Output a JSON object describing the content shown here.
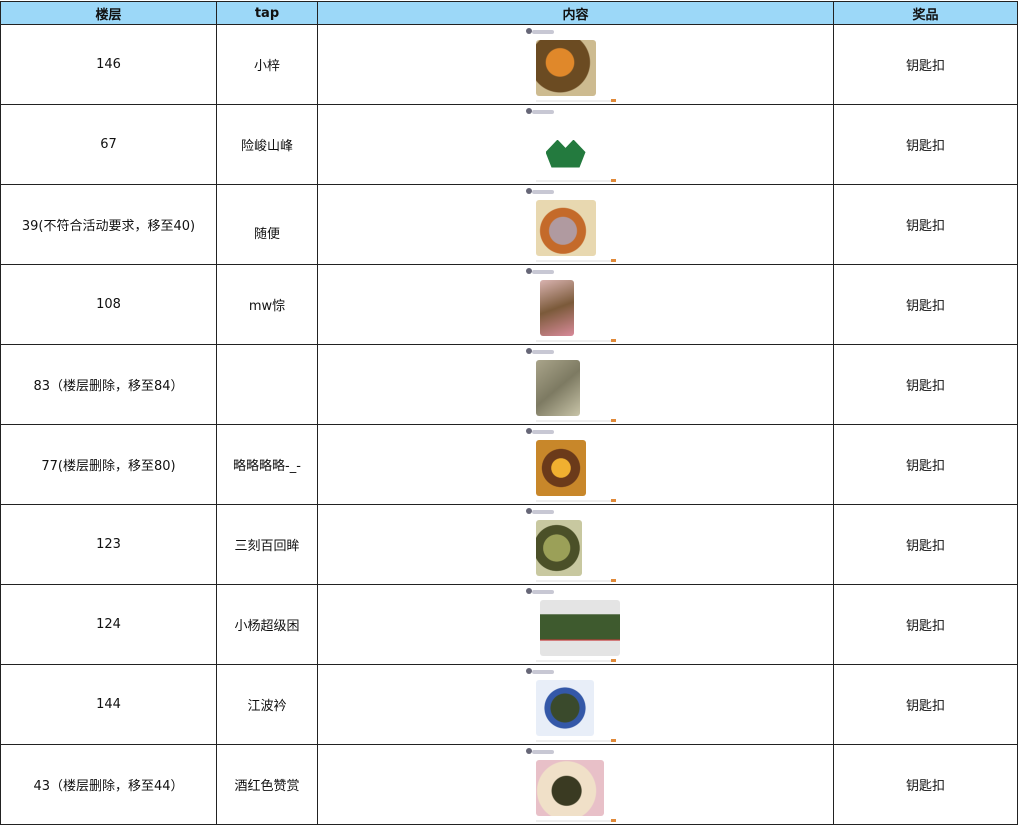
{
  "headers": {
    "floor": "楼层",
    "tap": "tap",
    "content": "内容",
    "prize": "奖品"
  },
  "rows": [
    {
      "floor": "146",
      "tap": "小梓",
      "prize": "钥匙扣",
      "thumb": "c-amber"
    },
    {
      "floor": "67",
      "tap": "险峻山峰",
      "prize": "钥匙扣",
      "thumb": "c-green"
    },
    {
      "floor": "39(不符合活动要求，移至40)",
      "tap": "随便",
      "prize": "钥匙扣",
      "thumb": "c-purple"
    },
    {
      "floor": "108",
      "tap": "mw悰",
      "prize": "钥匙扣",
      "thumb": "c-pink"
    },
    {
      "floor": "83（楼层删除，移至84）",
      "tap": "",
      "prize": "钥匙扣",
      "thumb": "c-gray"
    },
    {
      "floor": "77(楼层删除，移至80)",
      "tap": "略略略略-_-",
      "prize": "钥匙扣",
      "thumb": "c-gold"
    },
    {
      "floor": "123",
      "tap": "三刻百回眸",
      "prize": "钥匙扣",
      "thumb": "c-olive"
    },
    {
      "floor": "124",
      "tap": "小杨超级困",
      "prize": "钥匙扣",
      "thumb": "c-wide"
    },
    {
      "floor": "144",
      "tap": "江波衿",
      "prize": "钥匙扣",
      "thumb": "c-blue"
    },
    {
      "floor": "43（楼层删除，移至44）",
      "tap": "酒红色赞赏",
      "prize": "钥匙扣",
      "thumb": "c-cloth"
    }
  ]
}
